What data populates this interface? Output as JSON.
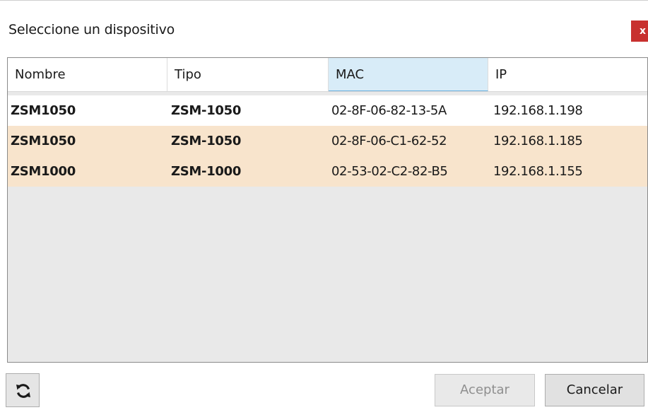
{
  "dialog": {
    "title": "Seleccione un dispositivo",
    "close_label": "x"
  },
  "table": {
    "columns": [
      "Nombre",
      "Tipo",
      "MAC",
      "IP"
    ],
    "sorted_column": "MAC",
    "rows": [
      {
        "nombre": "ZSM1050",
        "tipo": "ZSM-1050",
        "mac": "02-8F-06-82-13-5A",
        "ip": "192.168.1.198",
        "highlighted": false
      },
      {
        "nombre": "ZSM1050",
        "tipo": "ZSM-1050",
        "mac": "02-8F-06-C1-62-52",
        "ip": "192.168.1.185",
        "highlighted": true
      },
      {
        "nombre": "ZSM1000",
        "tipo": "ZSM-1000",
        "mac": "02-53-02-C2-82-B5",
        "ip": "192.168.1.155",
        "highlighted": true
      }
    ]
  },
  "buttons": {
    "refresh_icon": "refresh-icon",
    "accept_label": "Aceptar",
    "accept_enabled": false,
    "cancel_label": "Cancelar"
  },
  "colors": {
    "highlight_row": "#f8e4cc",
    "sorted_header": "#d8ecf8",
    "close_button": "#c8312f",
    "table_background": "#e9e9e9"
  }
}
